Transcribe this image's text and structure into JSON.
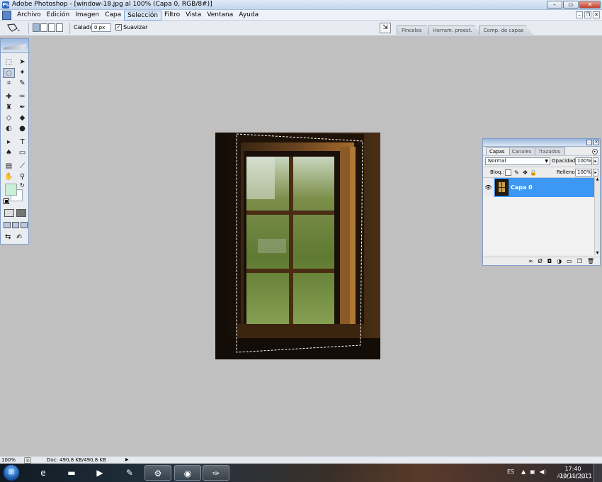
{
  "window": {
    "title": "Adobe Photoshop - [window-18.jpg al 100% (Capa 0, RGB/8#)]",
    "app_icon": "photoshop-icon",
    "controls": {
      "minimize": "–",
      "maximize": "▭",
      "close": "✕"
    }
  },
  "menu": {
    "items": [
      "Archivo",
      "Edición",
      "Imagen",
      "Capa",
      "Selección",
      "Filtro",
      "Vista",
      "Ventana",
      "Ayuda"
    ],
    "active": "Selección",
    "doc_controls": {
      "minimize": "–",
      "restore": "❐",
      "close": "✕"
    }
  },
  "options_bar": {
    "tool_icon": "polygonal-lasso-icon",
    "calado_label": "Calado:",
    "calado_value": "0 px",
    "suavizar_label": "Suavizar",
    "suavizar_checked": true,
    "palette_well_tabs": [
      "Pinceles",
      "Herram. preest.",
      "Comp. de capas"
    ]
  },
  "toolbox": {
    "foreground_color": "#c8f0d4",
    "background_color": "#ffffff"
  },
  "layers_panel": {
    "tabs": [
      "Capas",
      "Canales",
      "Trazados"
    ],
    "active_tab": "Capas",
    "blend_mode": "Normal",
    "opacity_label": "Opacidad:",
    "opacity_value": "100%",
    "lock_label": "Bloq.:",
    "fill_label": "Relleno:",
    "fill_value": "100%",
    "layers": [
      {
        "name": "Capa 0",
        "visible": true,
        "selected": true
      }
    ]
  },
  "status_bar": {
    "zoom": "100%",
    "doc_size": "Doc: 490,8 KB/490,8 KB"
  },
  "taskbar": {
    "language": "ES",
    "time": "17:40",
    "date": "10/11/2011",
    "apps": [
      "internet-explorer-icon",
      "explorer-folder-icon",
      "media-player-icon",
      "sketch-app-icon",
      "network-app-icon",
      "chrome-icon",
      "photoshop-taskbar-icon"
    ]
  },
  "watermark": "AULACLIC"
}
